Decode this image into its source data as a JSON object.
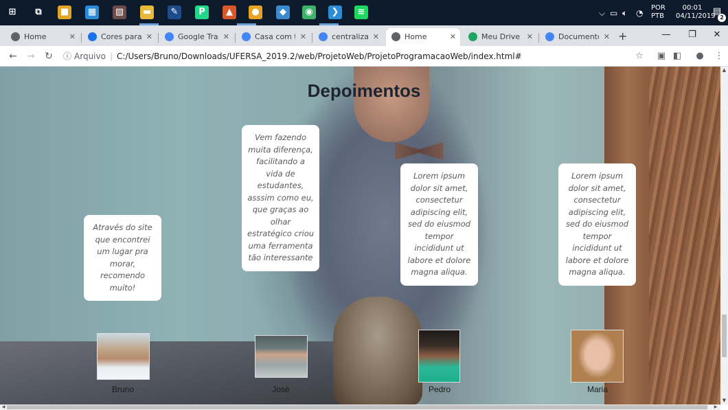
{
  "taskbar": {
    "apps": [
      {
        "name": "windows-start-icon",
        "glyph": "⊞",
        "color": "#0d1a2b"
      },
      {
        "name": "task-view-icon",
        "glyph": "⧉",
        "color": "#0d1a2b"
      },
      {
        "name": "app-colored-squares-icon",
        "glyph": "■",
        "color": "#e2a526"
      },
      {
        "name": "app-calculator-icon",
        "glyph": "▦",
        "color": "#2a8ad8"
      },
      {
        "name": "app-photo-icon",
        "glyph": "▨",
        "color": "#6b4b4b"
      },
      {
        "name": "folder-icon",
        "glyph": "▬",
        "color": "#e8b83a"
      },
      {
        "name": "paint-icon",
        "glyph": "✎",
        "color": "#1e4b8c"
      },
      {
        "name": "pycharm-icon",
        "glyph": "P",
        "color": "#21d789"
      },
      {
        "name": "matlab-icon",
        "glyph": "▲",
        "color": "#d8582a"
      },
      {
        "name": "chrome-icon",
        "glyph": "●",
        "color": "#e8a325"
      },
      {
        "name": "app-blue-icon",
        "glyph": "◆",
        "color": "#3b8ad0"
      },
      {
        "name": "app-green-icon",
        "glyph": "◉",
        "color": "#3cb36a"
      },
      {
        "name": "vscode-icon",
        "glyph": "❯",
        "color": "#2c8ed8"
      },
      {
        "name": "spotify-icon",
        "glyph": "≋",
        "color": "#1ed760"
      }
    ],
    "language": "POR",
    "layout": "PTB",
    "time": "00:01",
    "date": "04/11/2019",
    "notifications": "2"
  },
  "tabs": [
    {
      "label": "Home",
      "favicon": "globe-icon",
      "color": "#5f6368",
      "active": false
    },
    {
      "label": "Cores para Site",
      "favicon": "site-c-icon",
      "color": "#1a73e8",
      "active": false
    },
    {
      "label": "Google Tradut",
      "favicon": "translate-icon",
      "color": "#4285f4",
      "active": false
    },
    {
      "label": "Casa com três",
      "favicon": "google-g-icon",
      "color": "#4285f4",
      "active": false
    },
    {
      "label": "centralizar text",
      "favicon": "google-g-icon",
      "color": "#4285f4",
      "active": false
    },
    {
      "label": "Home",
      "favicon": "globe-icon",
      "color": "#5f6368",
      "active": true
    },
    {
      "label": "Meu Drive - Go",
      "favicon": "drive-icon",
      "color": "#1fa463",
      "active": false
    },
    {
      "label": "Documento se",
      "favicon": "docs-icon",
      "color": "#4285f4",
      "active": false
    }
  ],
  "toolbar": {
    "info": "ⓘ",
    "scheme": "Arquivo",
    "url": "C:/Users/Bruno/Downloads/UFERSA_2019.2/web/ProjetoWeb/ProjetoProgramacaoWeb/index.html#"
  },
  "page": {
    "title": "Depoimentos",
    "testimonials": [
      {
        "text": "Através do site que encontrei um lugar pra morar, recomendo muito!",
        "name": "Bruno"
      },
      {
        "text": "Vem fazendo muita diferença, facilitando a vida de estudantes, asssim como eu, que graças ao olhar estratégico criou uma ferramenta tão interessante",
        "name": "José"
      },
      {
        "text": "Lorem ipsum dolor sit amet, consectetur adipiscing elit, sed do eiusmod tempor incididunt ut labore et dolore magna aliqua.",
        "name": "Pedro"
      },
      {
        "text": "Lorem ipsum dolor sit amet, consectetur adipiscing elit, sed do eiusmod tempor incididunt ut labore et dolore magna aliqua.",
        "name": "Maria"
      }
    ]
  }
}
